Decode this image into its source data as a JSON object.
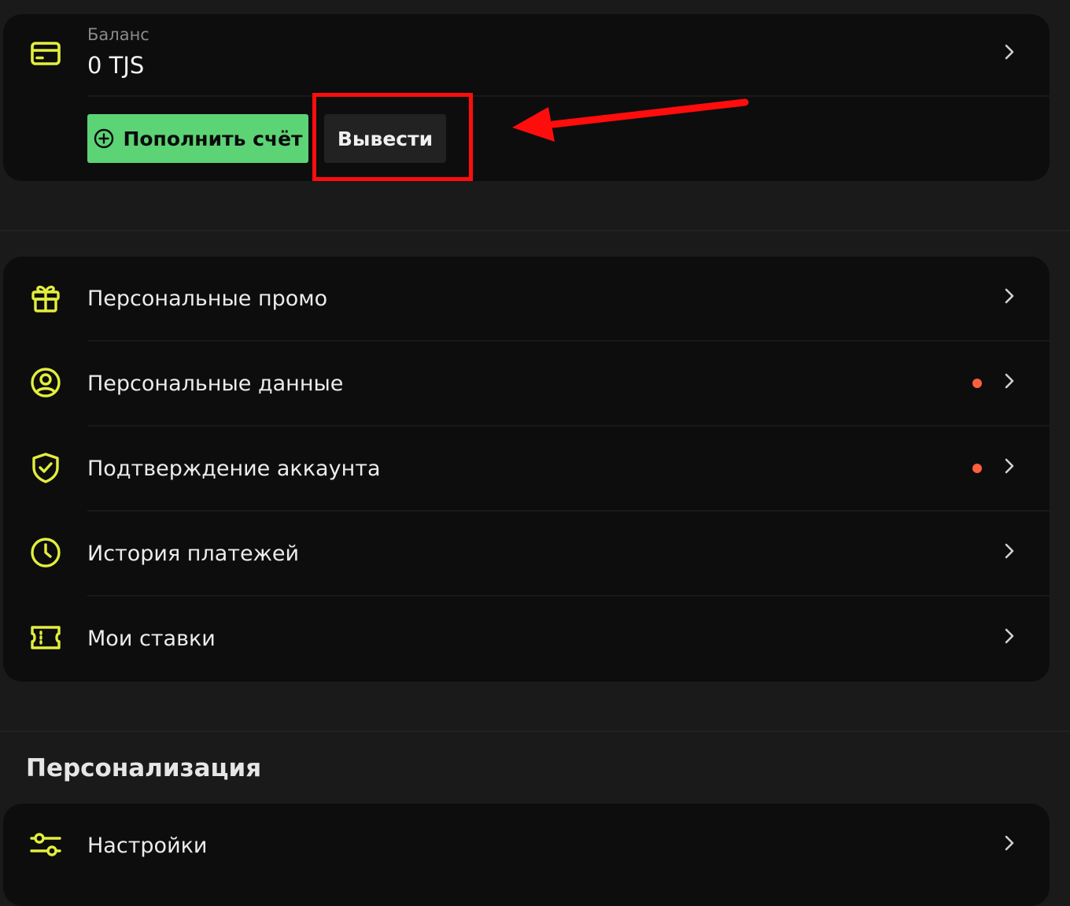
{
  "balance": {
    "label": "Баланс",
    "value": "0 TJS",
    "icon": "credit-card-icon"
  },
  "actions": {
    "deposit_label": "Пополнить счёт",
    "withdraw_label": "Вывести"
  },
  "menu": [
    {
      "label": "Персональные промо",
      "icon": "gift-icon",
      "notification": false
    },
    {
      "label": "Персональные данные",
      "icon": "user-circle-icon",
      "notification": true
    },
    {
      "label": "Подтверждение аккаунта",
      "icon": "shield-check-icon",
      "notification": true
    },
    {
      "label": "История платежей",
      "icon": "clock-icon",
      "notification": false
    },
    {
      "label": "Мои ставки",
      "icon": "ticket-icon",
      "notification": false
    }
  ],
  "personalization": {
    "title": "Персонализация",
    "items": [
      {
        "label": "Настройки",
        "icon": "sliders-icon"
      }
    ]
  },
  "colors": {
    "accent_icon": "#e3ee3d",
    "deposit_button": "#5cd375",
    "notification_dot": "#ff5f3f",
    "annotation": "#ff0d0d",
    "card_background": "#0d0d0d",
    "page_background": "#1a1a1a"
  }
}
